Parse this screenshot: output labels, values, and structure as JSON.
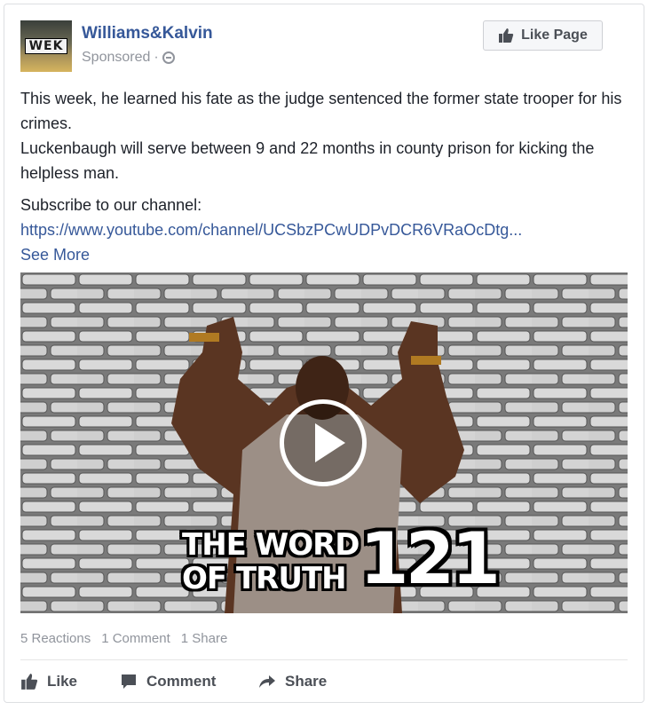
{
  "post": {
    "page_name": "Williams&Kalvin",
    "sponsored": "Sponsored",
    "dot": "·",
    "avatar_text": "WEK",
    "like_page_label": "Like Page",
    "text_line1": "This week, he learned his fate as the judge sentenced the former state trooper for his crimes.",
    "text_line2": "Luckenbaugh will serve between 9 and 22 months in county prison for kicking the helpless man.",
    "subscribe_label": "Subscribe to our channel:",
    "channel_link": "https://www.youtube.com/channel/UCSbzPCwUDPvDCR6VRaOcDtg...",
    "see_more": "See More"
  },
  "media": {
    "overlay_title_line1": "THE WORD",
    "overlay_title_line2": "OF TRUTH",
    "overlay_number": "121"
  },
  "counts": {
    "reactions": "5 Reactions",
    "comments": "1 Comment",
    "shares": "1 Share"
  },
  "actions": {
    "like": "Like",
    "comment": "Comment",
    "share": "Share"
  },
  "colors": {
    "link": "#365899",
    "meta": "#90949c",
    "action": "#4b4f56"
  },
  "icons": {
    "like_page": "thumbs-up-icon",
    "privacy": "globe-icon",
    "play": "play-icon",
    "like": "thumbs-up-icon",
    "comment": "comment-icon",
    "share": "share-arrow-icon"
  }
}
